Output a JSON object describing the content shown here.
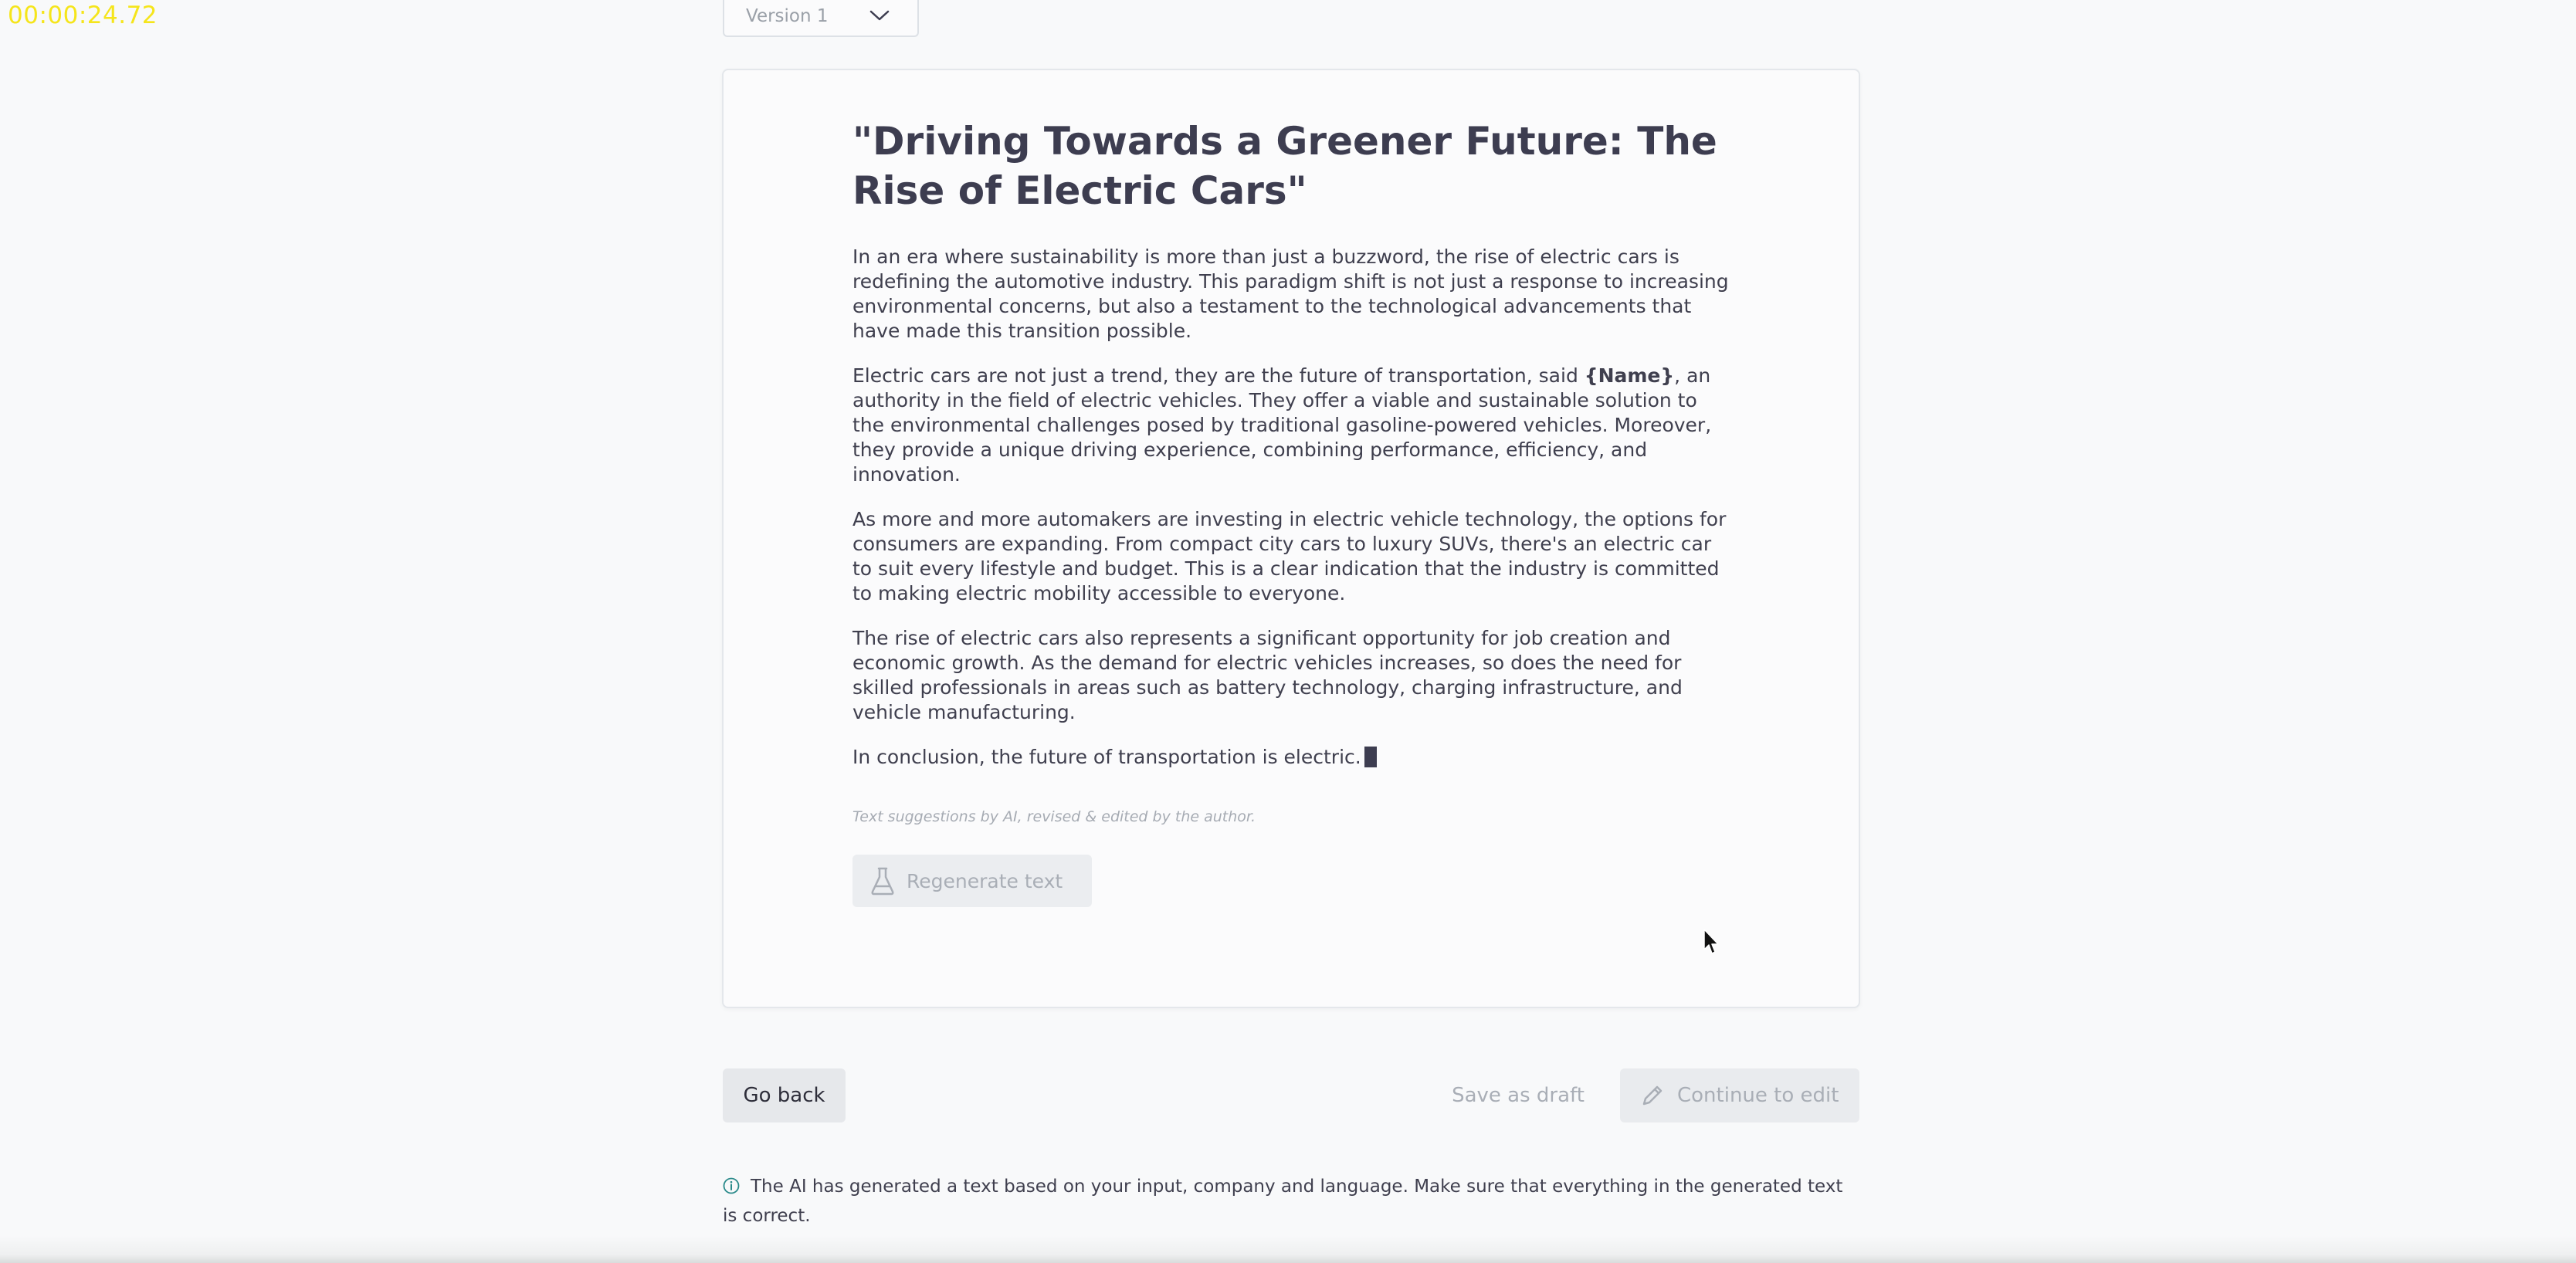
{
  "recording": {
    "timer": "00:00:24.72"
  },
  "version_select": {
    "value": "Version 1"
  },
  "article": {
    "title": "\"Driving Towards a Greener Future: The Rise of Electric Cars\"",
    "paragraph_1": "In an era where sustainability is more than just a buzzword, the rise of electric cars is redefining the automotive industry. This paradigm shift is not just a response to increasing environmental concerns, but also a testament to the technological advancements that have made this transition possible.",
    "paragraph_2_before": "Electric cars are not just a trend, they are the future of transportation, said ",
    "paragraph_2_name": "{Name}",
    "paragraph_2_after": ", an authority in the field of electric vehicles. They offer a viable and sustainable solution to the environmental challenges posed by traditional gasoline-powered vehicles. Moreover, they provide a unique driving experience, combining performance, efficiency, and innovation.",
    "paragraph_3": "As more and more automakers are investing in electric vehicle technology, the options for consumers are expanding. From compact city cars to luxury SUVs, there's an electric car to suit every lifestyle and budget. This is a clear indication that the industry is committed to making electric mobility accessible to everyone.",
    "paragraph_4": "The rise of electric cars also represents a significant opportunity for job creation and economic growth. As the demand for electric vehicles increases, so does the need for skilled professionals in areas such as battery technology, charging infrastructure, and vehicle manufacturing.",
    "paragraph_5": "In conclusion, the future of transportation is electric.",
    "disclaimer": "Text suggestions by AI, revised & edited by the author."
  },
  "buttons": {
    "regenerate": "Regenerate text",
    "go_back": "Go back",
    "save_draft": "Save as draft",
    "continue_edit": "Continue to edit"
  },
  "info": {
    "message": "The AI has generated a text based on your input, company and language. Make sure that everything in the generated text is correct."
  },
  "icons": {
    "chevron": "chevron-down-icon",
    "regenerate": "flask-icon",
    "continue": "pencil-icon",
    "info": "info-circle-icon"
  },
  "colors": {
    "timer": "#f5e51b",
    "title": "#3d3d50",
    "body_text": "#3f3f4e",
    "disabled_text": "#a9aeb6",
    "info_icon": "#2a8a8a",
    "background": "#f8f9fa"
  }
}
